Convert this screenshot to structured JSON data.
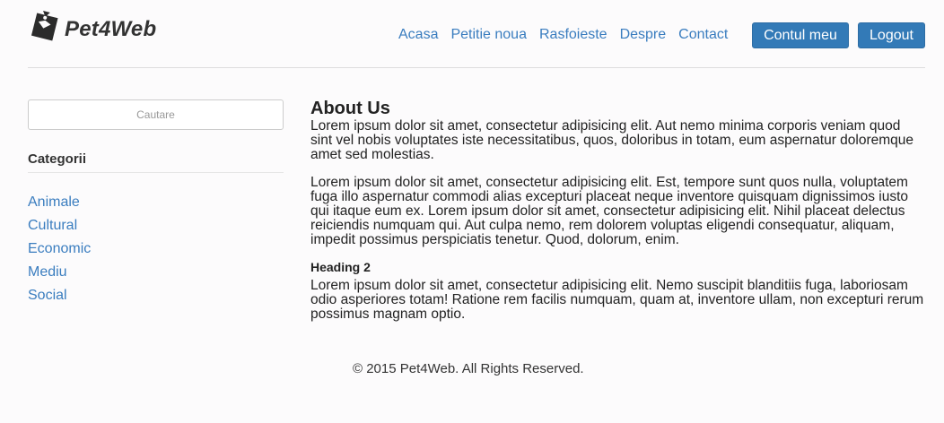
{
  "header": {
    "brand": "Pet4Web",
    "nav": [
      "Acasa",
      "Petitie noua",
      "Rasfoieste",
      "Despre",
      "Contact"
    ],
    "account_button": "Contul meu",
    "logout_button": "Logout"
  },
  "sidebar": {
    "search_placeholder": "Cautare",
    "categories_title": "Categorii",
    "categories": [
      "Animale",
      "Cultural",
      "Economic",
      "Mediu",
      "Social"
    ]
  },
  "main": {
    "title": "About Us",
    "paragraph1": "Lorem ipsum dolor sit amet, consectetur adipisicing elit. Aut nemo minima corporis veniam quod sint vel nobis voluptates iste necessitatibus, quos, doloribus in totam, eum aspernatur doloremque amet sed molestias.",
    "paragraph2": "Lorem ipsum dolor sit amet, consectetur adipisicing elit. Est, tempore sunt quos nulla, voluptatem fuga illo aspernatur commodi alias excepturi placeat neque inventore quisquam dignissimos iusto qui itaque eum ex. Lorem ipsum dolor sit amet, consectetur adipisicing elit. Nihil placeat delectus reiciendis numquam qui. Aut culpa nemo, rem dolorem voluptas eligendi consequatur, aliquam, impedit possimus perspiciatis tenetur. Quod, dolorum, enim.",
    "heading2": "Heading 2",
    "paragraph3": "Lorem ipsum dolor sit amet, consectetur adipisicing elit. Nemo suscipit blanditiis fuga, laboriosam odio asperiores totam! Ratione rem facilis numquam, quam at, inventore ullam, non excepturi rerum possimus magnam optio."
  },
  "footer": {
    "text": "© 2015 Pet4Web. All Rights Reserved."
  },
  "colors": {
    "link": "#3a7dbf",
    "button": "#337ab7",
    "background": "#fcfbfc"
  },
  "icons": {
    "logo": "tag-logo-icon"
  }
}
